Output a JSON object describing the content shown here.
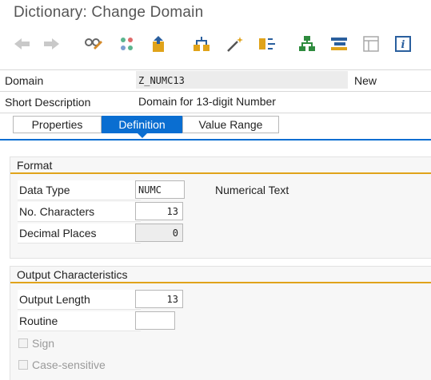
{
  "window": {
    "title": "Dictionary: Change Domain"
  },
  "toolbar": {
    "icons": [
      "back-icon",
      "forward-icon",
      "display-change-icon",
      "other-object-icon",
      "activate-icon",
      "where-used-icon",
      "magic-wand-icon",
      "navigation-icon",
      "hierarchy-icon",
      "object-list-icon",
      "list-view-icon",
      "info-icon"
    ]
  },
  "header": {
    "domain_label": "Domain",
    "domain_value": "Z_NUMC13",
    "domain_status": "New",
    "short_desc_label": "Short Description",
    "short_desc_value": "Domain for 13-digit Number"
  },
  "tabs": [
    {
      "label": "Properties"
    },
    {
      "label": "Definition",
      "active": true
    },
    {
      "label": "Value Range"
    }
  ],
  "format": {
    "title": "Format",
    "data_type": {
      "label": "Data Type",
      "value": "NUMC",
      "text": "Numerical Text"
    },
    "no_characters": {
      "label": "No. Characters",
      "value": "13"
    },
    "decimal_places": {
      "label": "Decimal Places",
      "value": "0"
    }
  },
  "output": {
    "title": "Output Characteristics",
    "output_length": {
      "label": "Output Length",
      "value": "13"
    },
    "routine": {
      "label": "Routine",
      "value": ""
    },
    "sign": {
      "label": "Sign",
      "checked": false
    },
    "case_sensitive": {
      "label": "Case-sensitive",
      "checked": false
    }
  },
  "colors": {
    "accent": "#0a6ed1",
    "group_underline": "#e0a31a"
  }
}
